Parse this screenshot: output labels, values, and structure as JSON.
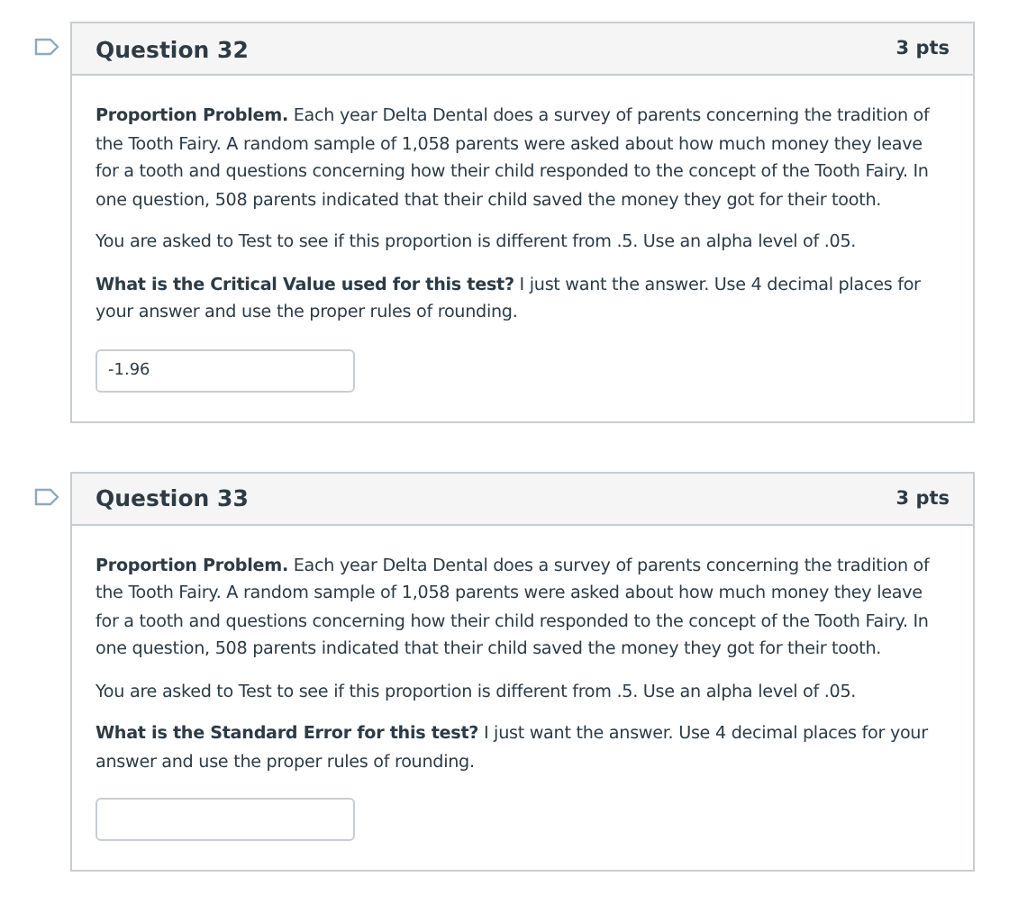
{
  "questions": [
    {
      "title": "Question 32",
      "points": "3 pts",
      "paragraphs": [
        "**Proportion Problem.**  Each year Delta Dental does a survey of parents concerning the tradition of the Tooth Fairy.  A random sample of 1,058 parents were asked about how much money they leave for a tooth and questions concerning how their child responded to the concept of the Tooth Fairy.  In one question, 508 parents indicated that their child saved the money they got for their tooth.",
        "You are asked to Test to see if this proportion is different from .5.  Use an alpha level of .05.",
        "**What is the Critical Value used for this test?**  I just want the answer. Use 4 decimal places for your answer and use the proper rules of rounding."
      ],
      "answer": "-1.96"
    },
    {
      "title": "Question 33",
      "points": "3 pts",
      "paragraphs": [
        "**Proportion Problem.**  Each year Delta Dental does a survey of parents concerning the tradition of the Tooth Fairy.  A random sample of 1,058 parents were asked about how much money they leave for a tooth and questions concerning how their child responded to the concept of the Tooth Fairy.  In one question, 508 parents indicated that their child saved the money they got for their tooth.",
        "You are asked to Test to see if this proportion is different from .5.  Use an alpha level of .05.",
        "**What is the Standard Error for this test?**  I just want the answer. Use 4 decimal places for your answer and use the proper rules of rounding."
      ]
    }
  ]
}
